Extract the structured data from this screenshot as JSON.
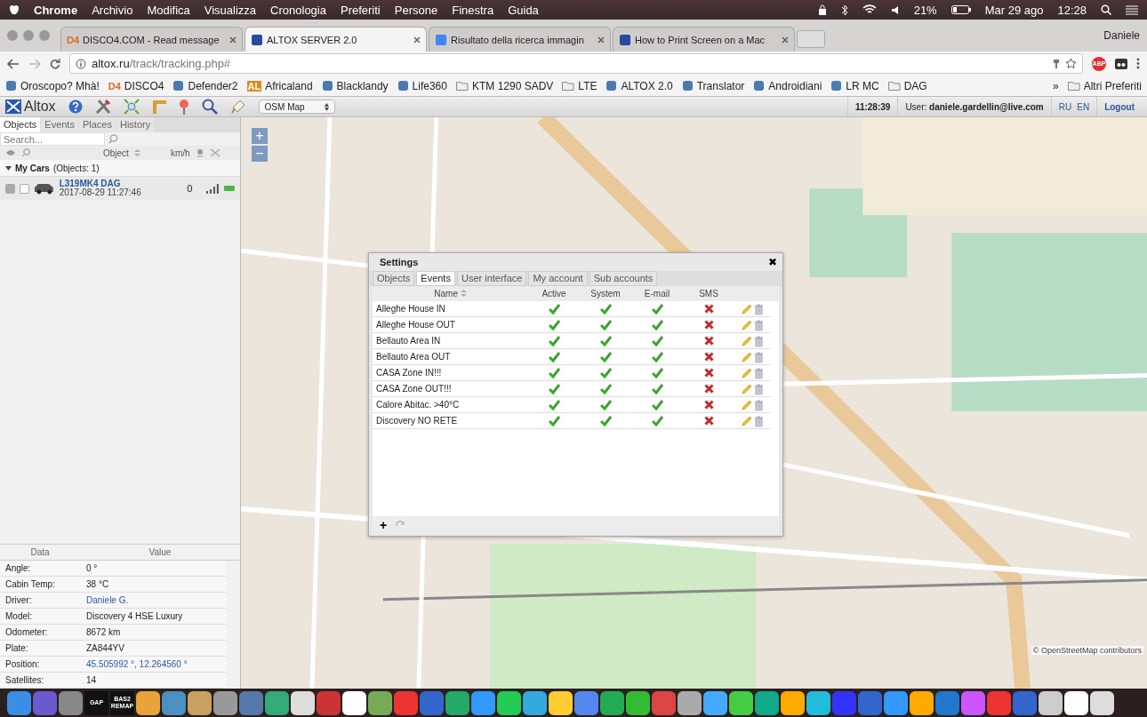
{
  "menu_bar": {
    "app": "Chrome",
    "items": [
      "Archivio",
      "Modifica",
      "Visualizza",
      "Cronologia",
      "Preferiti",
      "Persone",
      "Finestra",
      "Guida"
    ],
    "battery": "21%",
    "date": "Mar 29 ago",
    "time": "12:28"
  },
  "browser": {
    "tabs": [
      {
        "title": "DISCO4.COM - Read message",
        "icon_text": "D4",
        "selected": false
      },
      {
        "title": "ALTOX SERVER 2.0",
        "selected": true
      },
      {
        "title": "Risultato della ricerca immagin",
        "selected": false
      },
      {
        "title": "How to Print Screen on a Mac",
        "selected": false
      }
    ],
    "profile": "Daniele",
    "url_host": "altox.ru",
    "url_path": "/track/tracking.php#",
    "extension_text": "ABP",
    "bookmarks": [
      {
        "label": "Oroscopo? Mhà!",
        "kind": "site"
      },
      {
        "label": "DISCO4",
        "kind": "text",
        "icon_text": "D4"
      },
      {
        "label": "Defender2",
        "kind": "site"
      },
      {
        "label": "Africaland",
        "kind": "text",
        "icon_text": "AL"
      },
      {
        "label": "Blacklandy",
        "kind": "site"
      },
      {
        "label": "Life360",
        "kind": "site"
      },
      {
        "label": "KTM 1290 SADV",
        "kind": "folder"
      },
      {
        "label": "LTE",
        "kind": "folder"
      },
      {
        "label": "ALTOX 2.0",
        "kind": "site"
      },
      {
        "label": "Translator",
        "kind": "site"
      },
      {
        "label": "Androidiani",
        "kind": "site"
      },
      {
        "label": "LR MC",
        "kind": "site"
      },
      {
        "label": "DAG",
        "kind": "folder"
      }
    ],
    "overflow": "»",
    "other_bookmarks": "Altri Preferiti"
  },
  "app": {
    "logo": "Altox",
    "map_select": "OSM Map",
    "clock": "11:28:39",
    "user_label": "User:",
    "user": "daniele.gardellin@live.com",
    "languages": [
      "RU",
      "EN"
    ],
    "logout": "Logout"
  },
  "left_panel": {
    "tabs": [
      {
        "label": "Objects",
        "selected": true
      },
      {
        "label": "Events",
        "selected": false
      },
      {
        "label": "Places",
        "selected": false
      },
      {
        "label": "History",
        "selected": false
      }
    ],
    "search_placeholder": "Search...",
    "columns": [
      "Object",
      "km/h"
    ],
    "group": {
      "name": "My Cars",
      "count": "(Objects: 1)",
      "expanded": true
    },
    "objects": [
      {
        "name": "L319MK4 DAG",
        "time": "2017-08-29 11:27:46",
        "speed": "0",
        "visible": true,
        "selected": false
      }
    ]
  },
  "data_panel": {
    "columns": [
      "Data",
      "Value"
    ],
    "rows": [
      {
        "label": "Angle:",
        "value": "0 °",
        "link": false
      },
      {
        "label": "Cabin Temp:",
        "value": "38 °C",
        "link": false
      },
      {
        "label": "Driver:",
        "value": "Daniele G.",
        "link": true
      },
      {
        "label": "Model:",
        "value": "Discovery 4 HSE Luxury",
        "link": false
      },
      {
        "label": "Odometer:",
        "value": "8672 km",
        "link": false
      },
      {
        "label": "Plate:",
        "value": "ZA844YV",
        "link": false
      },
      {
        "label": "Position:",
        "value": "45.505992 °, 12.264560 °",
        "link": true
      },
      {
        "label": "Satellites:",
        "value": "14",
        "link": false
      }
    ]
  },
  "map": {
    "zoom_in": "+",
    "zoom_out": "−",
    "attribution": "© OpenStreetMap contributors"
  },
  "settings": {
    "title": "Settings",
    "close": "✖",
    "tabs": [
      {
        "label": "Objects",
        "selected": false
      },
      {
        "label": "Events",
        "selected": true
      },
      {
        "label": "User interface",
        "selected": false
      },
      {
        "label": "My account",
        "selected": false
      },
      {
        "label": "Sub accounts",
        "selected": false
      }
    ],
    "columns": [
      "Name",
      "Active",
      "System",
      "E-mail",
      "SMS"
    ],
    "rows": [
      {
        "name": "Alleghe House IN",
        "active": true,
        "system": true,
        "email": true,
        "sms": false
      },
      {
        "name": "Alleghe House OUT",
        "active": true,
        "system": true,
        "email": true,
        "sms": false
      },
      {
        "name": "Bellauto Area IN",
        "active": true,
        "system": true,
        "email": true,
        "sms": false
      },
      {
        "name": "Bellauto Area OUT",
        "active": true,
        "system": true,
        "email": true,
        "sms": false
      },
      {
        "name": "CASA Zone IN!!!",
        "active": true,
        "system": true,
        "email": true,
        "sms": false
      },
      {
        "name": "CASA Zone OUT!!!",
        "active": true,
        "system": true,
        "email": true,
        "sms": false
      },
      {
        "name": "Calore Abitac. >40°C",
        "active": true,
        "system": true,
        "email": true,
        "sms": false
      },
      {
        "name": "Discovery NO RETE",
        "active": true,
        "system": true,
        "email": true,
        "sms": false
      }
    ],
    "add": "+"
  },
  "dock": {
    "text_icons": [
      "GAP",
      "BAS2 REMAP"
    ]
  }
}
